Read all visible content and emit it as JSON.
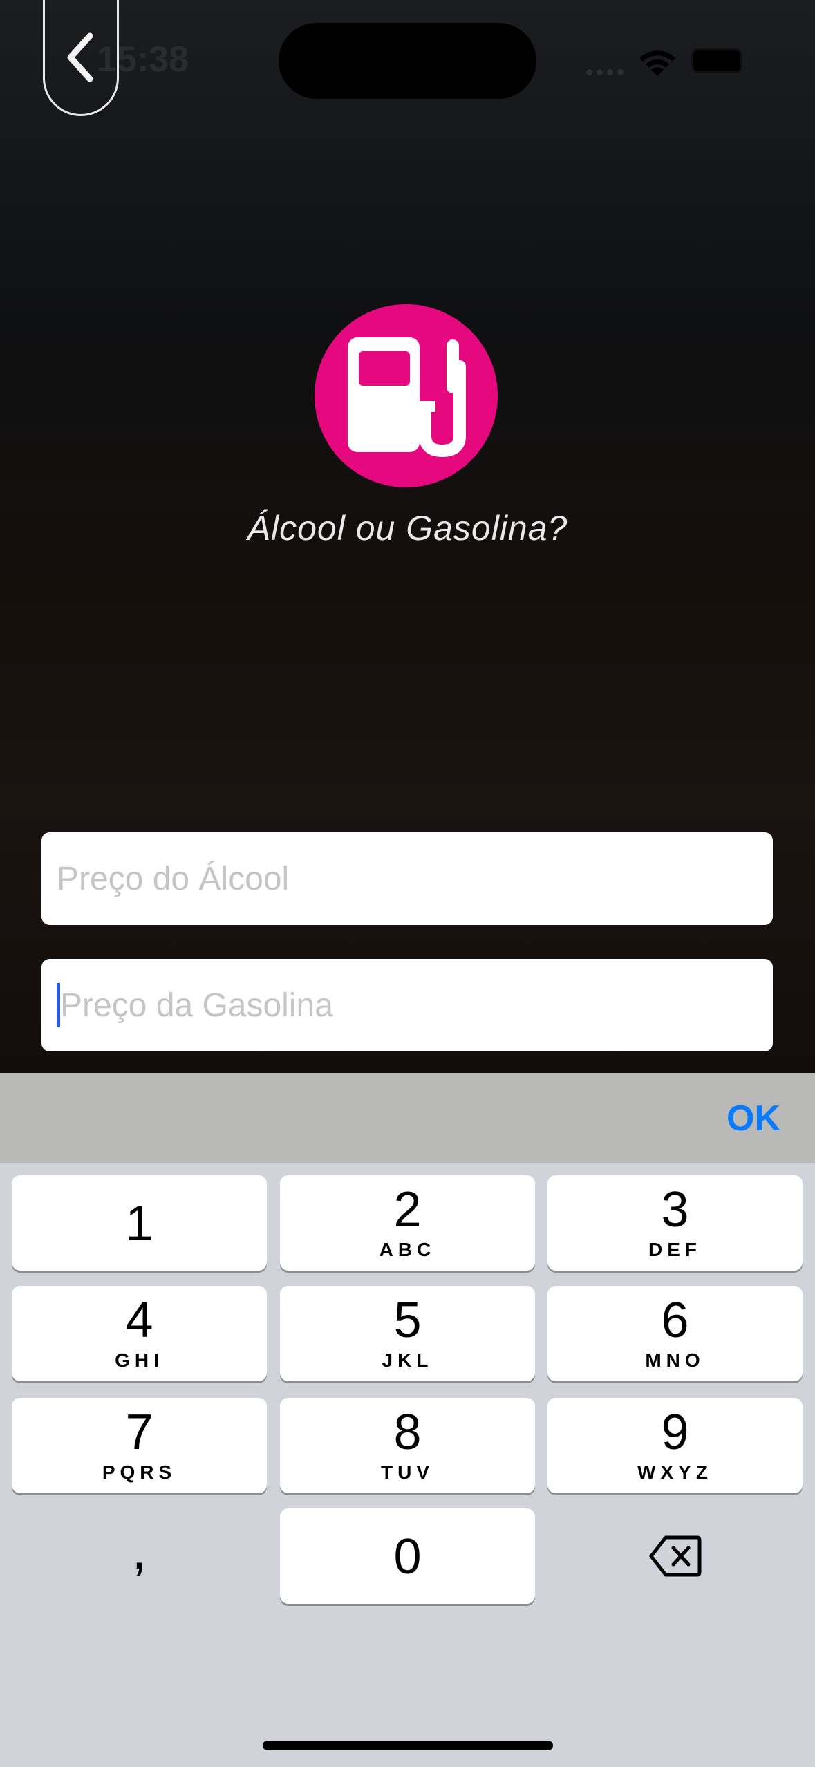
{
  "status_bar": {
    "time": "15:38"
  },
  "app": {
    "title": "Álcool ou Gasolina?",
    "logo": "fuel-pump-icon",
    "brand_color": "#e5087e"
  },
  "form": {
    "alcohol_placeholder": "Preço do Álcool",
    "gasoline_placeholder": "Preço da Gasolina"
  },
  "keyboard": {
    "ok_label": "OK",
    "keys": [
      {
        "num": "1",
        "letters": ""
      },
      {
        "num": "2",
        "letters": "ABC"
      },
      {
        "num": "3",
        "letters": "DEF"
      },
      {
        "num": "4",
        "letters": "GHI"
      },
      {
        "num": "5",
        "letters": "JKL"
      },
      {
        "num": "6",
        "letters": "MNO"
      },
      {
        "num": "7",
        "letters": "PQRS"
      },
      {
        "num": "8",
        "letters": "TUV"
      },
      {
        "num": "9",
        "letters": "WXYZ"
      },
      {
        "num": "0",
        "letters": ""
      }
    ],
    "comma": ","
  }
}
